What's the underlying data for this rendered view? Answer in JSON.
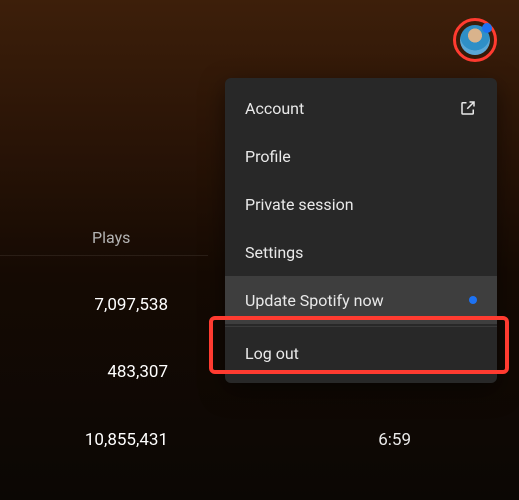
{
  "table": {
    "header_plays": "Plays",
    "rows": [
      {
        "plays": "7,097,538"
      },
      {
        "plays": "483,307"
      },
      {
        "plays": "10,855,431",
        "duration": "6:59"
      }
    ]
  },
  "menu": {
    "items": [
      {
        "label": "Account",
        "external": true
      },
      {
        "label": "Profile"
      },
      {
        "label": "Private session"
      },
      {
        "label": "Settings"
      },
      {
        "label": "Update Spotify now",
        "dot": true,
        "highlighted": true
      },
      {
        "label": "Log out",
        "divider_before": true
      }
    ]
  }
}
